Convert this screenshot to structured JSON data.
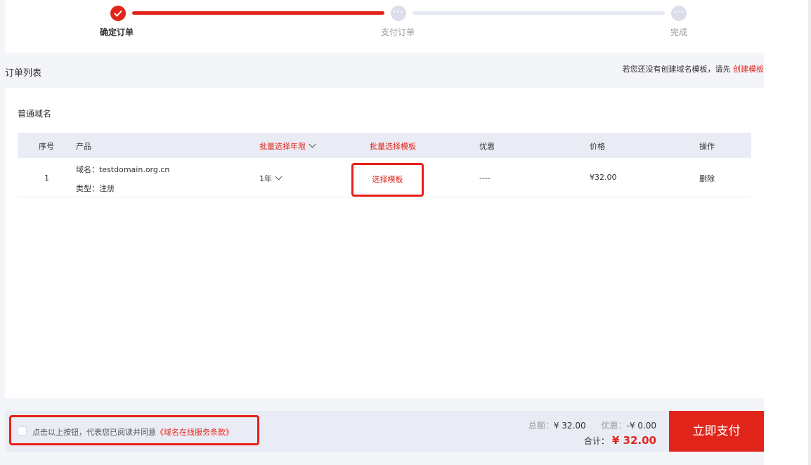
{
  "steps": [
    {
      "label": "确定订单",
      "status": "done"
    },
    {
      "label": "支付订单",
      "status": "todo"
    },
    {
      "label": "完成",
      "status": "todo"
    }
  ],
  "section_title": "订单列表",
  "hint": {
    "text": "若您还没有创建域名模板，请先",
    "link": "创建模板"
  },
  "sub_title": "普通域名",
  "table": {
    "headers": {
      "index": "序号",
      "product": "产品",
      "years": "批量选择年限",
      "template": "批量选择模板",
      "discount": "优惠",
      "price": "价格",
      "action": "操作"
    },
    "rows": [
      {
        "index": "1",
        "domain_label": "域名：testdomain.org.cn",
        "type_label": "类型：注册",
        "years": "1年",
        "template_button": "选择模板",
        "discount": "----",
        "price": "¥32.00",
        "action": "删除"
      }
    ]
  },
  "footer": {
    "agree_text": "点击以上按钮，代表您已阅读并同意",
    "terms_link": "《域名在线服务条款》",
    "total_label": "总额：",
    "total_value": "¥ 32.00",
    "discount_label": "优惠：",
    "discount_value": "-¥ 0.00",
    "sum_label": "合计：",
    "sum_value": "¥ 32.00",
    "pay_button": "立即支付"
  },
  "colors": {
    "accent": "#e1251b",
    "highlight": "#e8201a",
    "panel": "#eaecf5"
  }
}
